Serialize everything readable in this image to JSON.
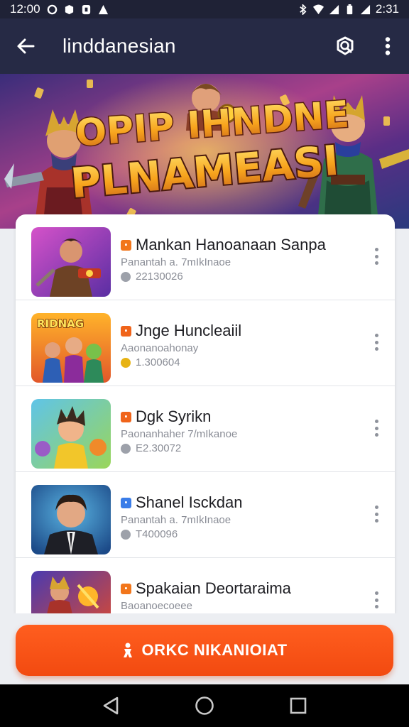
{
  "status_bar": {
    "time_left": "12:00",
    "time_right": "2:31"
  },
  "app_bar": {
    "title": "linddanesian"
  },
  "banner": {
    "line1": "OPIP IHNDNE",
    "line2": "PLNAMEASI"
  },
  "list": [
    {
      "title": "Mankan Hanoanaan Sanpa",
      "subtitle": "Panantah a. 7mIkInaoe",
      "meta": "22130026",
      "badge_color": "#f2761b",
      "meta_icon_color": "#9da1aa",
      "thumb": "warrior-icon"
    },
    {
      "title": "Jnge Huncleaiil",
      "subtitle": "Aaonanoahonay",
      "meta": "1.300604",
      "badge_color": "#f0641a",
      "meta_icon_color": "#e7b314",
      "thumb": "hero-group-icon"
    },
    {
      "title": "Dgk Syrikn",
      "subtitle": "Paonanhaher 7/mIkanoe",
      "meta": "E2.30072",
      "badge_color": "#f0641a",
      "meta_icon_color": "#9da1aa",
      "thumb": "cartoon-hero-icon"
    },
    {
      "title": "Shanel Isckdan",
      "subtitle": "Panantah a. 7mIkInaoe",
      "meta": "T400096",
      "badge_color": "#3a7de8",
      "meta_icon_color": "#9da1aa",
      "thumb": "portrait-icon"
    },
    {
      "title": "Spakaian Deortaraima",
      "subtitle": "Baoanoecoeee",
      "meta": "",
      "badge_color": "#f2761b",
      "meta_icon_color": "#9da1aa",
      "thumb": "battle-icon"
    }
  ],
  "cta": {
    "label": "ORKC NIKANIOIAT"
  }
}
